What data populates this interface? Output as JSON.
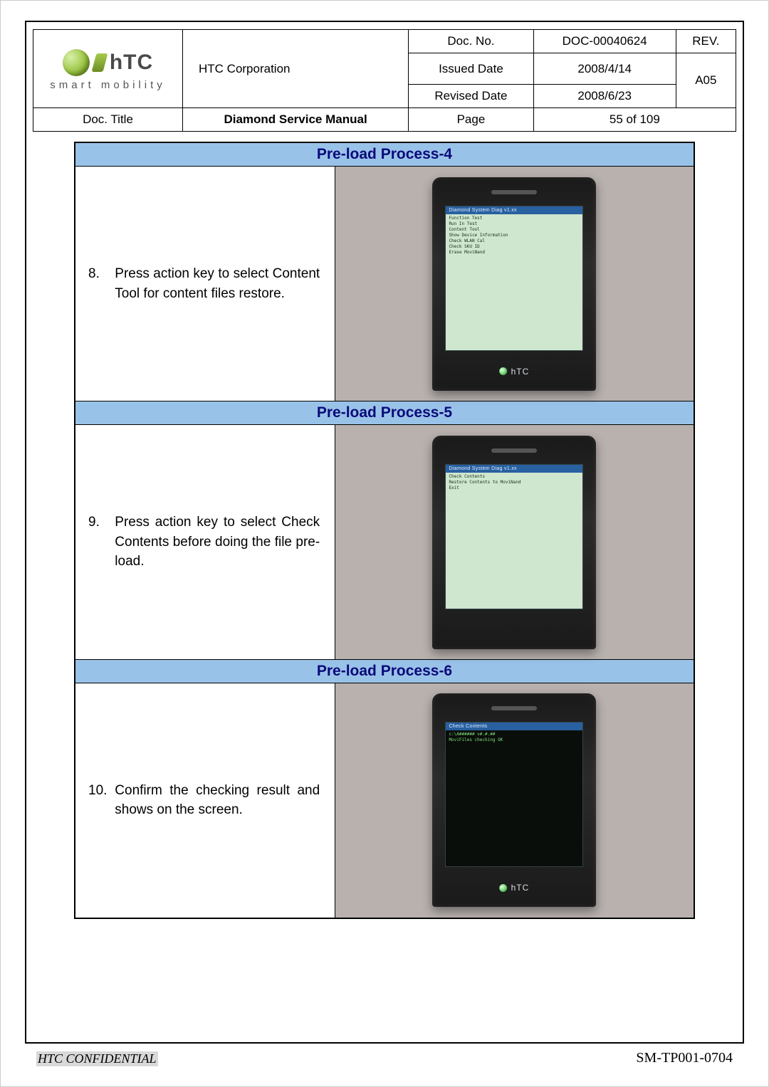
{
  "header": {
    "logo": {
      "htc_text": "hTC",
      "tagline": "smart mobility"
    },
    "corporation": "HTC Corporation",
    "doc_no_label": "Doc. No.",
    "doc_no_value": "DOC-00040624",
    "rev_label": "REV.",
    "rev_value": "A05",
    "issued_date_label": "Issued Date",
    "issued_date_value": "2008/4/14",
    "revised_date_label": "Revised Date",
    "revised_date_value": "2008/6/23",
    "doc_title_label": "Doc. Title",
    "doc_title_value": "Diamond Service Manual",
    "page_label": "Page",
    "page_value": "55  of  109"
  },
  "steps": [
    {
      "title": "Pre-load Process-4",
      "num": "8.",
      "text": "Press action key to select Content Tool for content files restore.",
      "screen_bar": "Diamond System Diag  v1.xx",
      "screen_lines": "Function Test\nRun In Test\nContent Tool\nShow Device Information\nCheck WLAN Cal\nCheck SKU ID\nErase MoviNand",
      "phone_label": "hTC",
      "dark": false
    },
    {
      "title": "Pre-load Process-5",
      "num": "9.",
      "text": "Press action key to select Check Contents before doing the file pre-load.",
      "screen_bar": "Diamond System Diag  v1.xx",
      "screen_lines": "Check Contents\nRestore Contents to MoviNand\nExit",
      "phone_label": "",
      "dark": false
    },
    {
      "title": "Pre-load Process-6",
      "num": "10.",
      "text": "Confirm the checking result and shows on the screen.",
      "screen_bar": "Check Contents",
      "screen_lines": "c:\\A###### v#.#.##\nMoviFiles checking OK",
      "phone_label": "hTC",
      "dark": true
    }
  ],
  "footer": {
    "confidential": "HTC CONFIDENTIAL",
    "doc_code": "SM-TP001-0704"
  }
}
